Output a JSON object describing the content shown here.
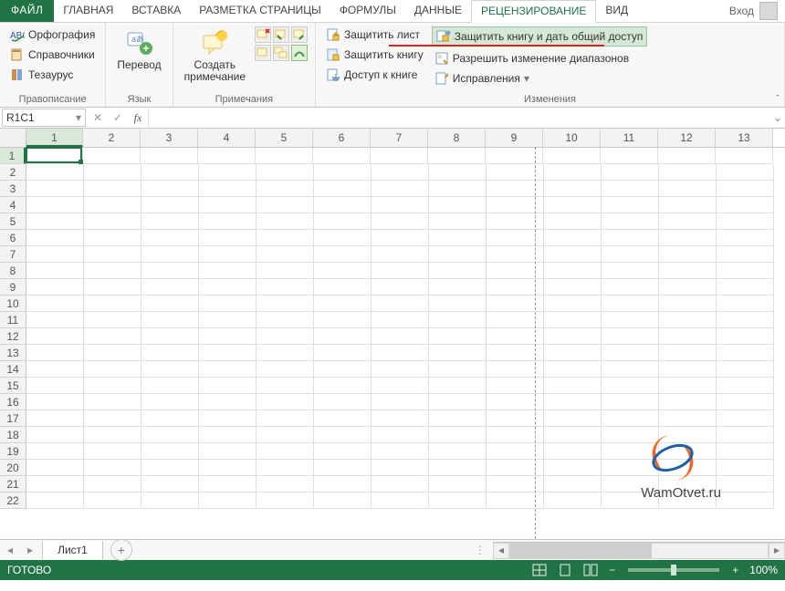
{
  "tabs": {
    "file": "ФАЙЛ",
    "home": "ГЛАВНАЯ",
    "insert": "ВСТАВКА",
    "layout": "РАЗМЕТКА СТРАНИЦЫ",
    "formulas": "ФОРМУЛЫ",
    "data": "ДАННЫЕ",
    "review": "РЕЦЕНЗИРОВАНИЕ",
    "view": "ВИД"
  },
  "account": {
    "label": "Вход"
  },
  "ribbon": {
    "proofing": {
      "label": "Правописание",
      "spell": "Орфография",
      "refs": "Справочники",
      "thes": "Тезаурус"
    },
    "language": {
      "label": "Язык",
      "translate": "Перевод"
    },
    "comments": {
      "label": "Примечания",
      "new": "Создать\nпримечание"
    },
    "changes": {
      "label": "Изменения",
      "protect_sheet": "Защитить лист",
      "protect_book": "Защитить книгу",
      "share_book": "Доступ к книге",
      "protect_share": "Защитить книгу и дать общий доступ",
      "allow_ranges": "Разрешить изменение диапазонов",
      "track": "Исправления"
    }
  },
  "namebox": "R1C1",
  "col_headers": [
    "1",
    "2",
    "3",
    "4",
    "5",
    "6",
    "7",
    "8",
    "9",
    "10",
    "11",
    "12",
    "13"
  ],
  "row_count": 22,
  "sheet": {
    "name": "Лист1"
  },
  "status": {
    "ready": "ГОТОВО",
    "zoom_pct": "100%"
  },
  "watermark": "WamOtvet.ru",
  "colors": {
    "brand": "#217346"
  }
}
